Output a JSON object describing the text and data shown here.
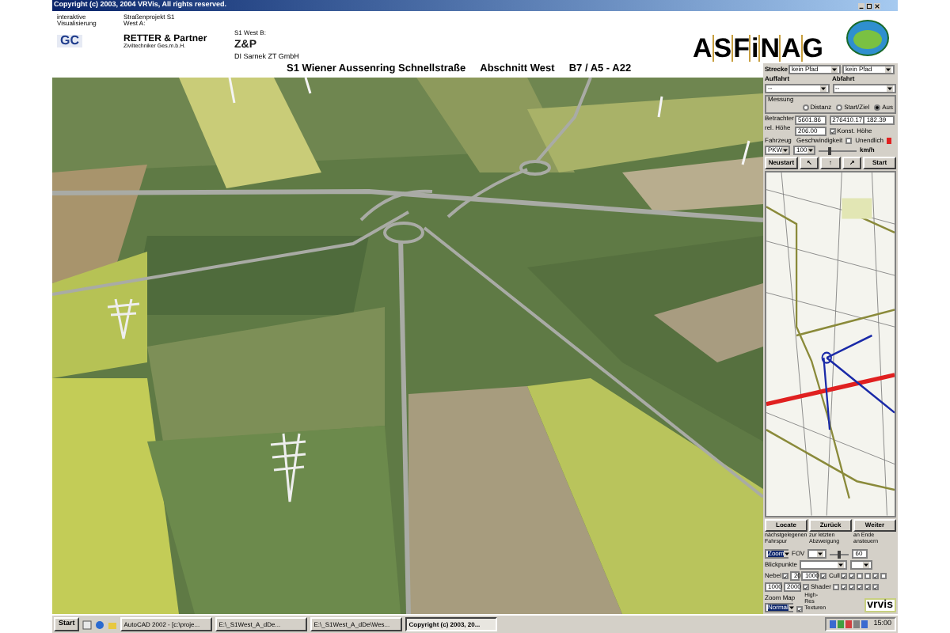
{
  "window": {
    "title": "Copyright (c) 2003, 2004 VRVis, All rights reserved."
  },
  "header": {
    "visualisation": {
      "caption": "interaktive Visualisierung",
      "logo": "GC"
    },
    "project_a": {
      "caption": "Straßenprojekt S1 West A:",
      "logo": "RETTER & Partner",
      "logo_subtitle": "Ziviltechniker Ges.m.b.H."
    },
    "project_b": {
      "caption": "S1 West B:",
      "logo": "Z&P",
      "company": "DI Sarnek ZT GmbH"
    },
    "brand": "ASFiNAG"
  },
  "title_line": [
    "S1 Wiener Aussenring Schnellstraße",
    "Abschnitt West",
    "B7 / A5 - A22"
  ],
  "panel": {
    "route": {
      "label": "Strecke",
      "values": [
        "kein Pfad",
        "kein Pfad"
      ]
    },
    "ramps": [
      {
        "label": "Auffahrt",
        "value": "--"
      },
      {
        "label": "Abfahrt",
        "value": "--"
      }
    ],
    "measure": {
      "label": "Messung",
      "options": [
        {
          "label": "Distanz",
          "selected": false
        },
        {
          "label": "Start/Ziel",
          "selected": false
        },
        {
          "label": "Aus",
          "selected": true
        }
      ]
    },
    "viewer": {
      "labels": [
        "Betrachter",
        "rel. Höhe"
      ],
      "values": [
        "5601.86",
        "276410.17",
        "182.39",
        "206.00"
      ],
      "const_height": {
        "label": "Konst. Höhe",
        "checked": true
      }
    },
    "vehicle": {
      "label": "Fahrzeug",
      "value": "PKW"
    },
    "speed": {
      "label": "Geschwindigkeit",
      "value": "100",
      "level": 0.3,
      "unit": "km/h",
      "unlimited": {
        "label": "Unendlich",
        "checked": false
      }
    },
    "nav_buttons": [
      "Neustart",
      "↖",
      "↑",
      "↗",
      "Start"
    ],
    "actions": [
      {
        "label": "Locate",
        "hint": "nächstgelegenen Fahrspur"
      },
      {
        "label": "Zurück",
        "hint": "zur letzten Abzweigung"
      },
      {
        "label": "Weiter",
        "hint": "an Ende ansteuern"
      }
    ],
    "zoom": {
      "value": "Zoom",
      "fov_label": "FOV",
      "level": 0.5,
      "fov": "60"
    },
    "viewpoints": {
      "label": "Blickpunkte"
    },
    "fog": {
      "label": "Nebel",
      "checked": true,
      "near": "20",
      "far": "1000",
      "cull": {
        "label": "Cull",
        "checked": true
      },
      "flags": [
        true,
        true,
        false,
        false,
        true,
        false
      ]
    },
    "render": {
      "values": [
        "1000",
        "2000"
      ],
      "checked": true,
      "shader": {
        "label": "Shader",
        "checked": false
      },
      "flags": [
        true,
        true,
        true,
        true,
        true
      ]
    },
    "zoom_map": {
      "label": "Zoom Map",
      "value": "Normal",
      "high_res": {
        "label": "High-Res Texturen",
        "checked": true
      },
      "logo": "vrvis"
    }
  },
  "taskbar": {
    "start": "Start",
    "tasks": [
      {
        "label": "AutoCAD 2002 - [c:\\proje...",
        "selected": false
      },
      {
        "label": "E:\\_S1West_A_dDe...",
        "selected": false
      },
      {
        "label": "E:\\_S1West_A_dDe\\Wes...",
        "selected": false
      },
      {
        "label": "Copyright (c) 2003, 20...",
        "selected": true
      }
    ],
    "clock": "15:00"
  }
}
